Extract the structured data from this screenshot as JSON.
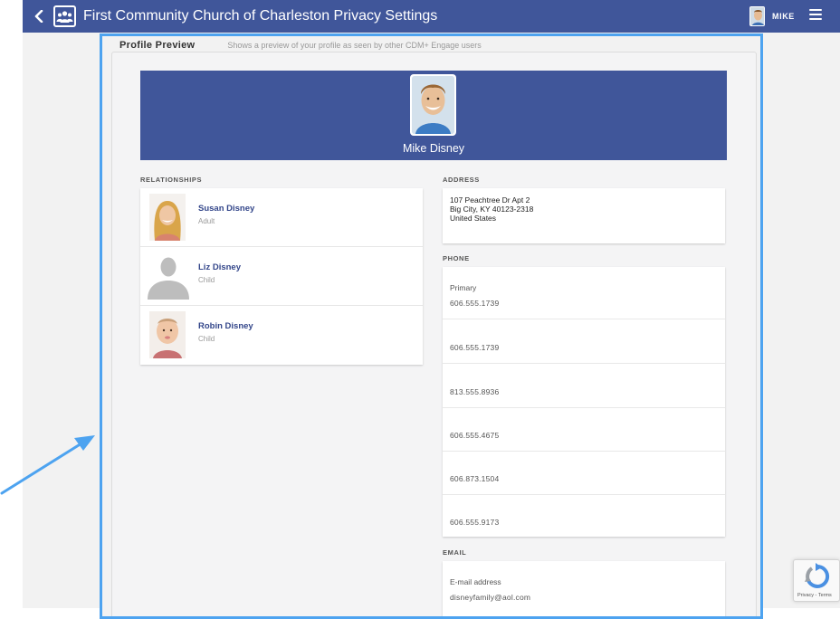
{
  "header": {
    "title": "First Community Church of Charleston  Privacy Settings",
    "user_name": "MIKE",
    "back_icon": "chevron-left-icon",
    "logo_icon": "people-group-icon",
    "menu_icon": "hamburger-menu-icon",
    "bg_color": "#40569a"
  },
  "panel": {
    "title": "Profile Preview",
    "subtitle": "Shows a preview of your profile as seen by other CDM+ Engage users",
    "highlight_color": "#4da3f0"
  },
  "profile": {
    "name": "Mike Disney"
  },
  "relationships": {
    "label": "RELATIONSHIPS",
    "items": [
      {
        "name": "Susan Disney",
        "role": "Adult"
      },
      {
        "name": "Liz Disney",
        "role": "Child"
      },
      {
        "name": "Robin Disney",
        "role": "Child"
      }
    ]
  },
  "address": {
    "label": "ADDRESS",
    "line1": "107 Peachtree Dr Apt 2",
    "line2": "Big City, KY 40123-2318",
    "line3": "United States"
  },
  "phone": {
    "label": "PHONE",
    "items": [
      {
        "type": "Primary",
        "number": "606.555.1739"
      },
      {
        "type": "",
        "number": "606.555.1739"
      },
      {
        "type": "",
        "number": "813.555.8936"
      },
      {
        "type": "",
        "number": "606.555.4675"
      },
      {
        "type": "",
        "number": "606.873.1504"
      },
      {
        "type": "",
        "number": "606.555.9173"
      }
    ]
  },
  "email": {
    "label": "EMAIL",
    "type": "E-mail address",
    "value": "disneyfamily@aol.com"
  },
  "recaptcha": {
    "text": "Privacy - Terms"
  }
}
